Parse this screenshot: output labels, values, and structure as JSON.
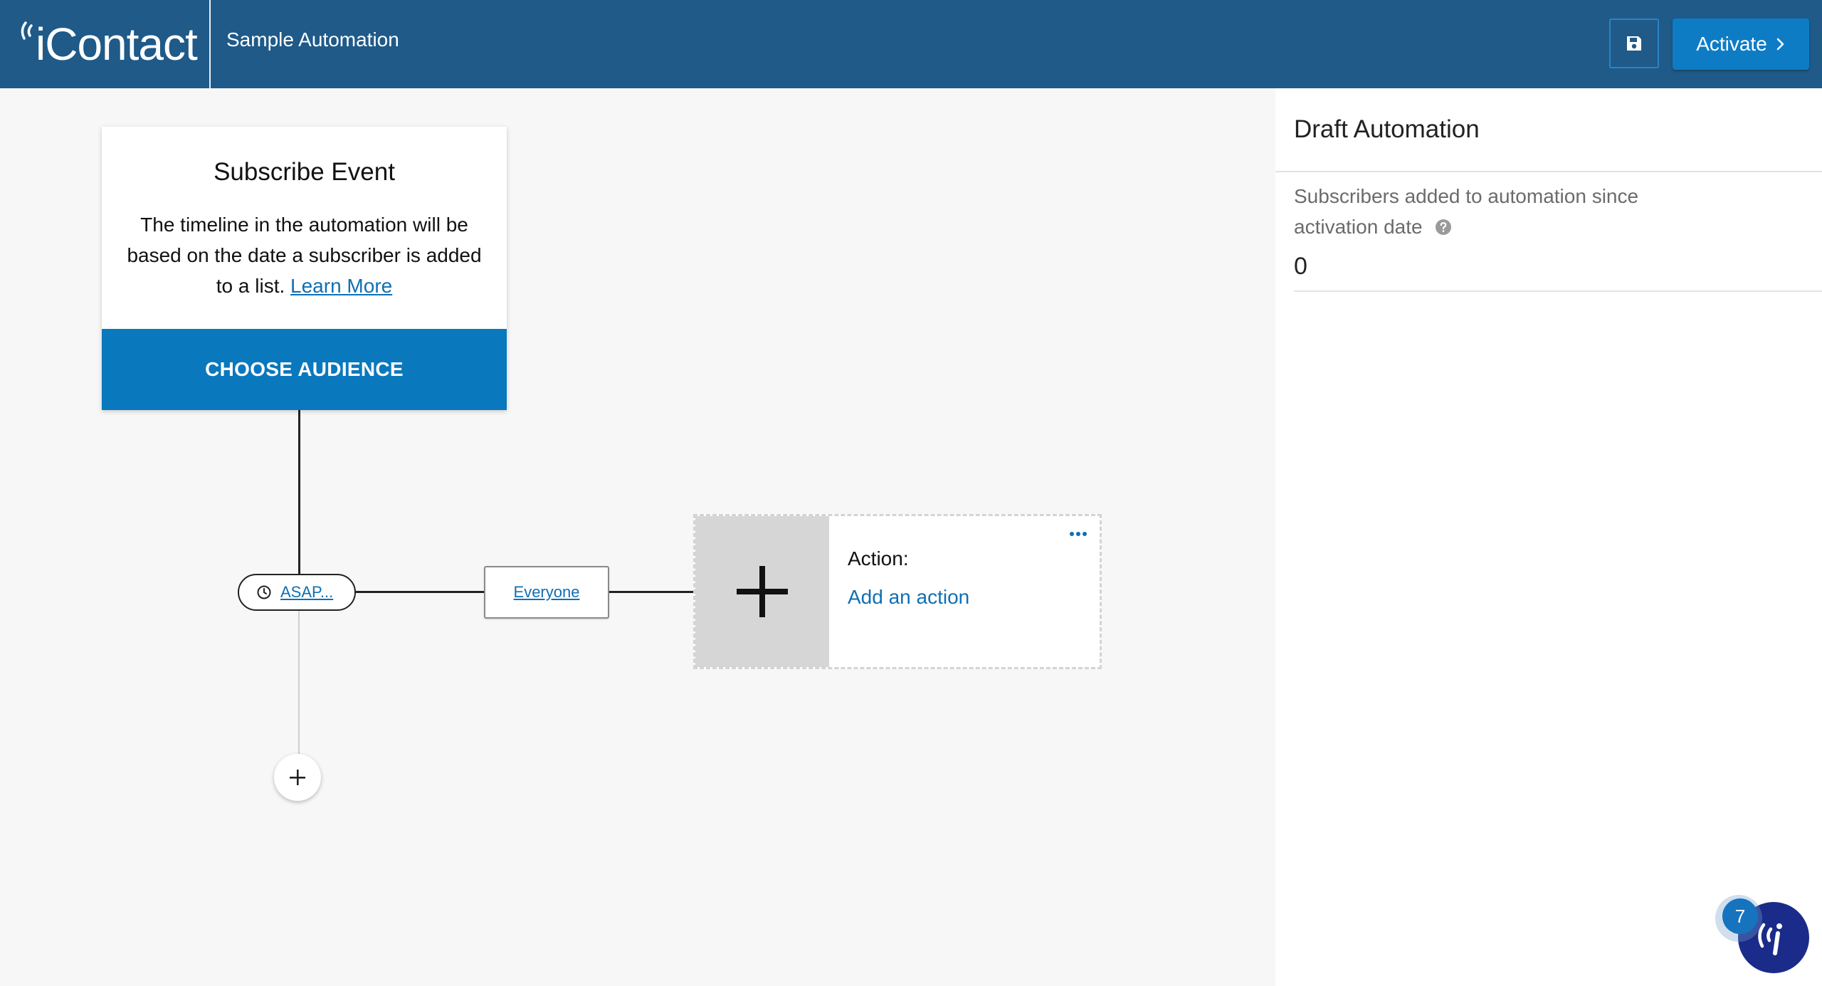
{
  "header": {
    "logo_text": "iContact",
    "automation_name": "Sample Automation",
    "save_icon": "floppy-disk-icon",
    "activate_label": "Activate",
    "colors": {
      "bar": "#1f5a88",
      "activate": "#0e7cc5"
    }
  },
  "canvas": {
    "subscribe_card": {
      "title": "Subscribe Event",
      "description": "The timeline in the automation will be based on the date a subscriber is added to a list.",
      "learn_more": "Learn More",
      "choose_audience": "CHOOSE AUDIENCE"
    },
    "timing_pill": {
      "icon": "clock-icon",
      "label": "ASAP..."
    },
    "segment": {
      "label": "Everyone"
    },
    "action_card": {
      "label": "Action:",
      "link": "Add an action",
      "menu_icon": "more-dots-icon"
    },
    "add_step_icon": "plus-icon"
  },
  "panel": {
    "title": "Draft Automation",
    "stat_label": "Subscribers added to automation since activation date",
    "stat_value": "0",
    "help_icon": "question-circle-icon"
  },
  "help_widget": {
    "badge_count": "7",
    "icon": "icontact-help-icon"
  }
}
